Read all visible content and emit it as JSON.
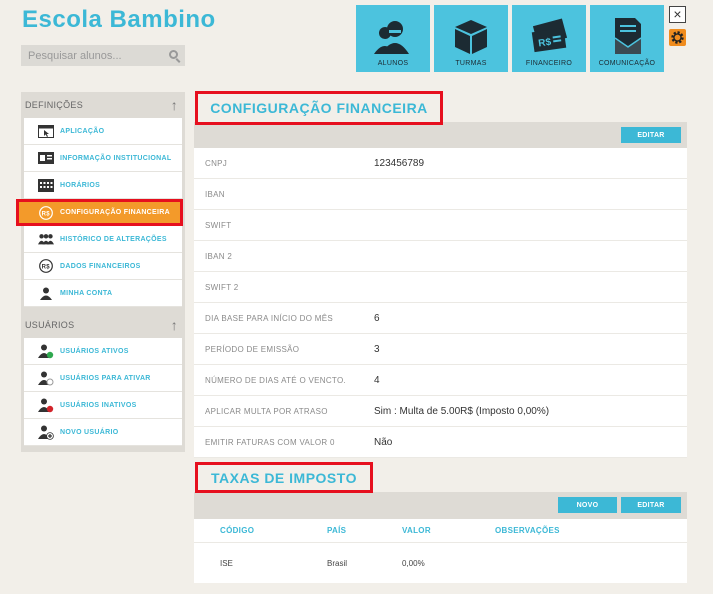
{
  "app": {
    "title": "Escola Bambino"
  },
  "search": {
    "placeholder": "Pesquisar alunos..."
  },
  "topnav": [
    {
      "label": "ALUNOS",
      "icon": "students-icon"
    },
    {
      "label": "TURMAS",
      "icon": "box-icon"
    },
    {
      "label": "FINANCEIRO",
      "icon": "money-icon"
    },
    {
      "label": "COMUNICAÇÃO",
      "icon": "document-mail-icon"
    }
  ],
  "window": {
    "close": "×"
  },
  "sidebar": {
    "definicoes": {
      "title": "DEFINIÇÕES",
      "items": [
        {
          "label": "APLICAÇÃO",
          "icon": "cursor-window-icon"
        },
        {
          "label": "INFORMAÇÃO INSTITUCIONAL",
          "icon": "id-card-icon"
        },
        {
          "label": "HORÁRIOS",
          "icon": "calendar-icon"
        },
        {
          "label": "CONFIGURAÇÃO FINANCEIRA",
          "icon": "currency-icon",
          "active": true
        },
        {
          "label": "HISTÓRICO DE ALTERAÇÕES",
          "icon": "group-icon"
        },
        {
          "label": "DADOS FINANCEIROS",
          "icon": "currency-icon"
        },
        {
          "label": "MINHA CONTA",
          "icon": "user-icon"
        }
      ]
    },
    "usuarios": {
      "title": "USUÁRIOS",
      "items": [
        {
          "label": "USUÁRIOS ATIVOS",
          "icon": "user-active-icon"
        },
        {
          "label": "USUÁRIOS PARA ATIVAR",
          "icon": "user-pending-icon"
        },
        {
          "label": "USUÁRIOS INATIVOS",
          "icon": "user-inactive-icon"
        },
        {
          "label": "NOVO USUÁRIO",
          "icon": "user-add-icon"
        }
      ]
    }
  },
  "finance": {
    "title": "CONFIGURAÇÃO FINANCEIRA",
    "edit_label": "EDITAR",
    "rows": [
      {
        "label": "CNPJ",
        "value": "123456789"
      },
      {
        "label": "IBAN",
        "value": ""
      },
      {
        "label": "SWIFT",
        "value": ""
      },
      {
        "label": "IBAN 2",
        "value": ""
      },
      {
        "label": "SWIFT 2",
        "value": ""
      },
      {
        "label": "DIA BASE PARA INÍCIO DO MÊS",
        "value": "6"
      },
      {
        "label": "PERÍODO DE EMISSÃO",
        "value": "3"
      },
      {
        "label": "NÚMERO DE DIAS ATÉ O VENCTO.",
        "value": "4"
      },
      {
        "label": "APLICAR MULTA POR ATRASO",
        "value": "Sim  : Multa de 5.00R$  (Imposto 0,00%)"
      },
      {
        "label": "EMITIR FATURAS COM VALOR 0",
        "value": "Não"
      }
    ]
  },
  "taxes": {
    "title": "TAXAS DE IMPOSTO",
    "new_label": "NOVO",
    "edit_label": "EDITAR",
    "columns": [
      "CÓDIGO",
      "PAÍS",
      "VALOR",
      "OBSERVAÇÕES"
    ],
    "rows": [
      {
        "codigo": "ISE",
        "pais": "Brasil",
        "valor": "0,00%",
        "observacoes": ""
      }
    ]
  },
  "colors": {
    "accent": "#3cb8d6",
    "active": "#f39a2a",
    "highlight": "#e60f1e"
  }
}
